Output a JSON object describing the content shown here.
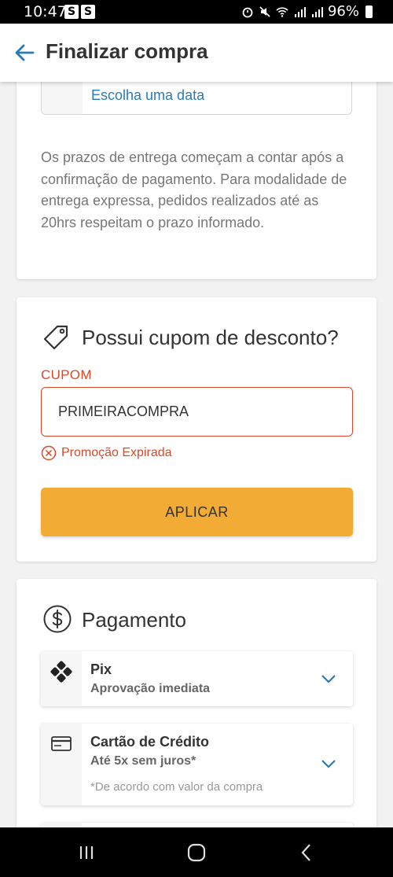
{
  "status_bar": {
    "time": "10:47",
    "badges": [
      "S",
      "S"
    ],
    "battery": "96%"
  },
  "app_bar": {
    "title": "Finalizar compra",
    "back_icon": "arrow-left-icon"
  },
  "delivery": {
    "choose_date_link": "Escolha uma data",
    "notice": "Os prazos de entrega começam a contar após a confirmação de pagamento. Para modalidade de entrega expressa, pedidos realizados até as 20hrs respeitam o prazo informado."
  },
  "coupon": {
    "title": "Possui cupom de desconto?",
    "label": "CUPOM",
    "value": "PRIMEIRACOMPRA",
    "error": "Promoção Expirada",
    "apply_label": "APLICAR",
    "error_color": "#d64a2a",
    "button_color": "#f2ac35"
  },
  "payment": {
    "title": "Pagamento",
    "options": [
      {
        "title": "Pix",
        "subtitle": "Aprovação imediata",
        "icon": "pix-icon"
      },
      {
        "title": "Cartão de Crédito",
        "subtitle": "Até 5x sem juros*",
        "note": "*De acordo com valor da compra",
        "icon": "credit-card-icon"
      }
    ],
    "accent_color": "#2a7ab8"
  }
}
